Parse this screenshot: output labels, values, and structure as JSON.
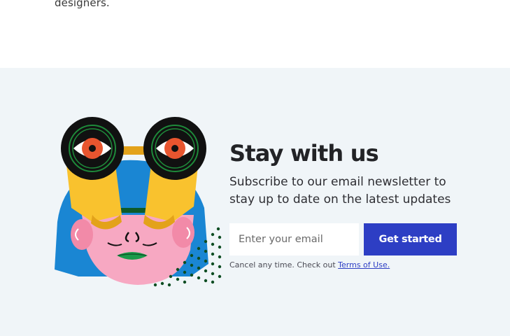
{
  "top": {
    "trailing_text": "designers."
  },
  "newsletter": {
    "heading": "Stay with us",
    "subtext": "Subscribe to our email newsletter to stay up to date on the latest updates",
    "email_placeholder": "Enter your email",
    "button_label": "Get started",
    "disclaimer_prefix": "Cancel any time. Check out ",
    "terms_link": "Terms of Use.",
    "illustration_icon": "binoculars-face-illustration"
  },
  "colors": {
    "section_bg": "#f0f5f8",
    "button_bg": "#2d3ec4",
    "heading": "#222326"
  }
}
